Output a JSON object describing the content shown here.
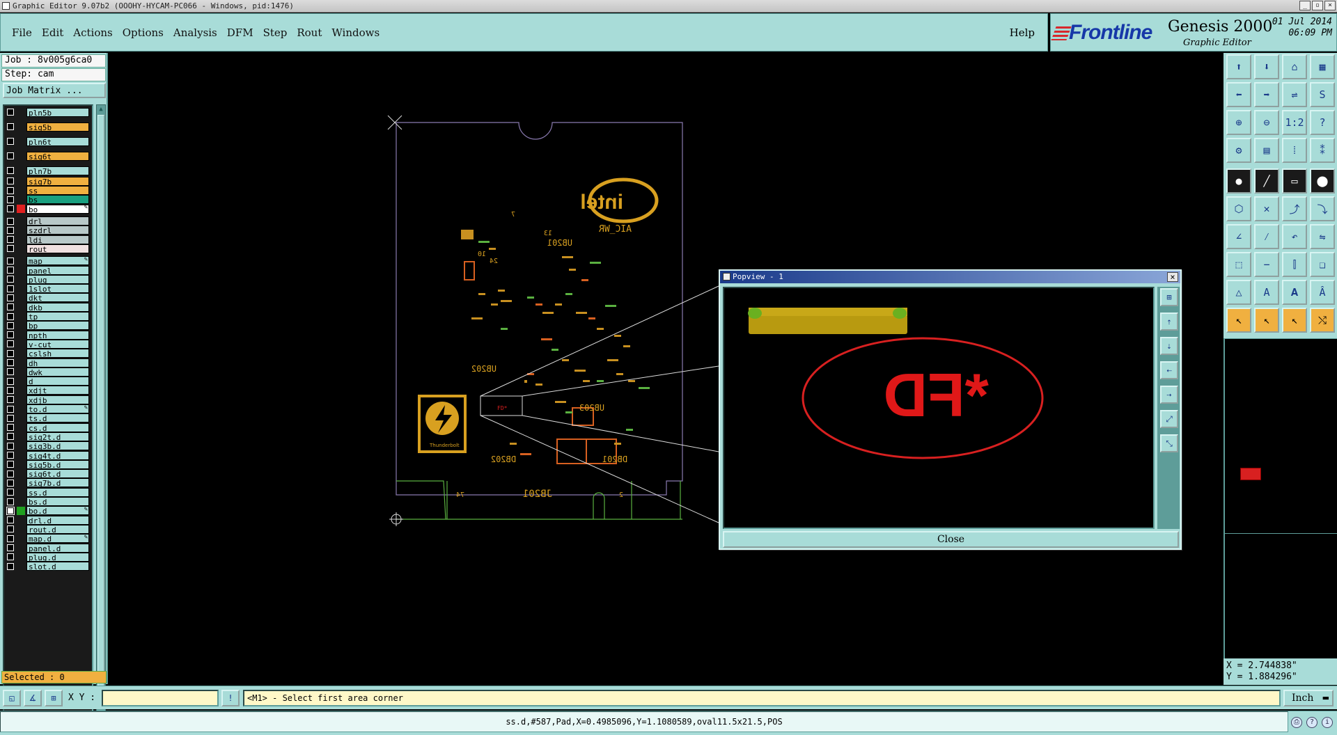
{
  "window": {
    "title": "Graphic Editor 9.07b2 (OOOHY-HYCAM-PC066 - Windows, pid:1476)"
  },
  "menu": [
    "File",
    "Edit",
    "Actions",
    "Options",
    "Analysis",
    "DFM",
    "Step",
    "Rout",
    "Windows"
  ],
  "help_label": "Help",
  "brand": {
    "logo": "Frontline",
    "product": "Genesis 2000",
    "subtitle": "Graphic Editor",
    "date": "01 Jul 2014",
    "time": "06:09 PM"
  },
  "job": "Job : 8v005g6ca0",
  "step": "Step: cam",
  "job_matrix_button": "Job Matrix ...",
  "layers": [
    {
      "name": "pln5b",
      "color": "teal"
    },
    {
      "name": "sig5b",
      "color": "orange"
    },
    {
      "name": "pln6t",
      "color": "teal"
    },
    {
      "name": "sig6t",
      "color": "orange"
    },
    {
      "name": "pln7b",
      "color": "teal"
    },
    {
      "name": "sig7b",
      "color": "orange"
    },
    {
      "name": "ss",
      "color": "orange"
    },
    {
      "name": "bs",
      "color": "green"
    },
    {
      "name": "bo",
      "color": "white",
      "swatch": "#e02020",
      "editable": true
    },
    {
      "name": "drl",
      "color": "grey"
    },
    {
      "name": "szdrl",
      "color": "grey"
    },
    {
      "name": "ldi",
      "color": "grey"
    },
    {
      "name": "rout",
      "color": "pink"
    },
    {
      "name": "map",
      "color": "teal",
      "editable": true
    },
    {
      "name": "panel",
      "color": "teal"
    },
    {
      "name": "plug",
      "color": "teal"
    },
    {
      "name": "1slot",
      "color": "teal"
    },
    {
      "name": "dkt",
      "color": "teal"
    },
    {
      "name": "dkb",
      "color": "teal"
    },
    {
      "name": "tp",
      "color": "teal"
    },
    {
      "name": "bp",
      "color": "teal"
    },
    {
      "name": "npth",
      "color": "teal"
    },
    {
      "name": "v-cut",
      "color": "teal"
    },
    {
      "name": "cslsh",
      "color": "teal"
    },
    {
      "name": "dh",
      "color": "teal"
    },
    {
      "name": "dwk",
      "color": "teal"
    },
    {
      "name": "d",
      "color": "teal"
    },
    {
      "name": "xdjt",
      "color": "teal"
    },
    {
      "name": "xdjb",
      "color": "teal"
    },
    {
      "name": "to.d",
      "color": "teal",
      "editable": true
    },
    {
      "name": "ts.d",
      "color": "teal"
    },
    {
      "name": "cs.d",
      "color": "teal"
    },
    {
      "name": "sig2t.d",
      "color": "teal"
    },
    {
      "name": "sig3b.d",
      "color": "teal"
    },
    {
      "name": "sig4t.d",
      "color": "teal"
    },
    {
      "name": "sig5b.d",
      "color": "teal"
    },
    {
      "name": "sig6t.d",
      "color": "teal"
    },
    {
      "name": "sig7b.d",
      "color": "teal"
    },
    {
      "name": "ss.d",
      "color": "teal"
    },
    {
      "name": "bs.d",
      "color": "teal"
    },
    {
      "name": "bo.d",
      "color": "teal",
      "swatch": "#20a020",
      "checked": true,
      "editable": true
    },
    {
      "name": "drl.d",
      "color": "teal"
    },
    {
      "name": "rout.d",
      "color": "teal"
    },
    {
      "name": "map.d",
      "color": "teal",
      "editable": true
    },
    {
      "name": "panel.d",
      "color": "teal"
    },
    {
      "name": "plug.d",
      "color": "teal"
    },
    {
      "name": "slot.d",
      "color": "teal"
    }
  ],
  "selected": "Selected : 0",
  "popview": {
    "title": "Popview - 1",
    "close_label": "Close",
    "text": "*FD"
  },
  "coords": {
    "x": "X = 2.744838\"",
    "y": "Y = 1.884296\""
  },
  "command": {
    "xy_label": "X Y :",
    "xy_value": "",
    "prompt": "<M1> - Select first area corner",
    "unit": "Inch"
  },
  "status": "ss.d,#587,Pad,X=0.4985096,Y=1.1080589,oval11.5x21.5,POS"
}
